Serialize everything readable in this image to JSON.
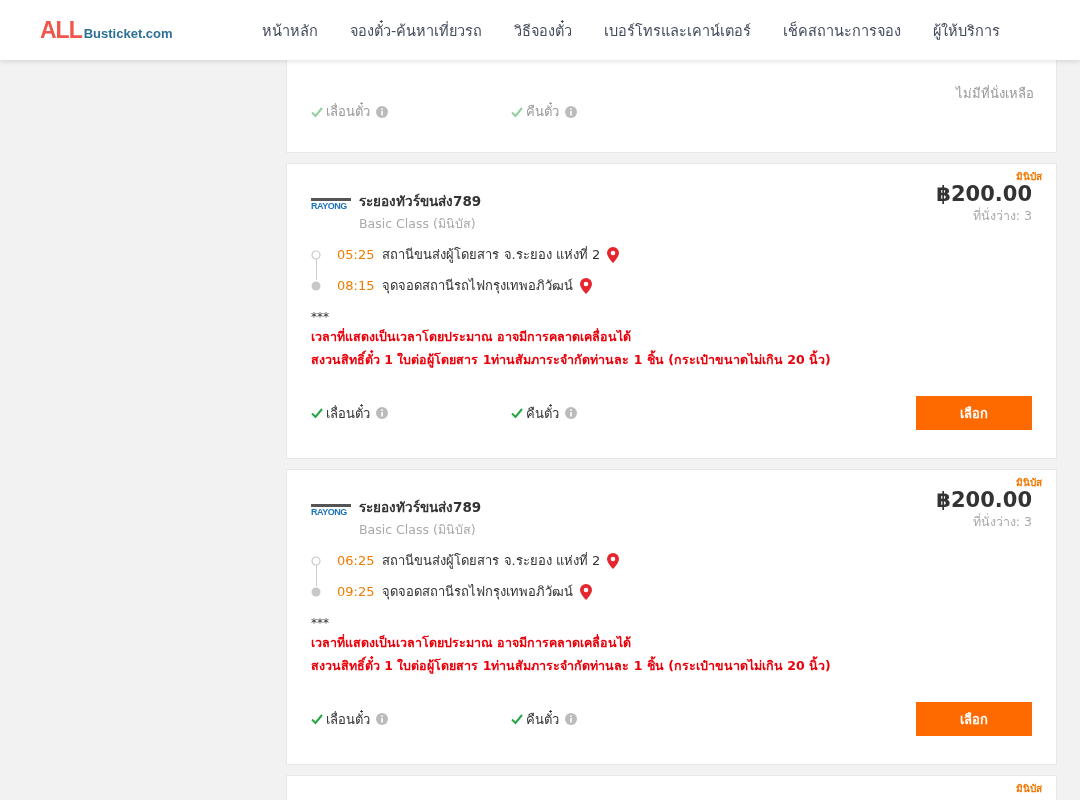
{
  "logo": {
    "part_1": "ALL",
    "part_2": "Busticket.com"
  },
  "nav": [
    {
      "label": "หน้าหลัก"
    },
    {
      "label": "จองตั๋ว-ค้นหาเที่ยวรถ"
    },
    {
      "label": "วิธีจองตั๋ว"
    },
    {
      "label": "เบอร์โทรและเคาน์เตอร์"
    },
    {
      "label": "เช็คสถานะการจอง"
    },
    {
      "label": "ผู้ให้บริการ"
    }
  ],
  "trips": [
    {
      "available": false,
      "status": "ไม่มีที่นั่งเหลือ",
      "features": [
        {
          "label": "เลื่อนตั๋ว",
          "checked": true
        },
        {
          "label": "คืนตั๋ว",
          "checked": true
        }
      ]
    },
    {
      "available": true,
      "tag": "มินิบัส",
      "operator_logo": "RAYONG",
      "operator": "ระยองทัวร์ขนส่ง789",
      "class": "Basic Class (มินิบัส)",
      "price": "฿200.00",
      "seats": "ที่นั่งว่าง: 3",
      "stops": [
        {
          "time": "05:25",
          "place": "สถานีขนส่งผู้โดยสาร จ.ระยอง แห่งที่ 2"
        },
        {
          "time": "08:15",
          "place": "จุดจอดสถานีรถไฟกรุงเทพอภิวัฒน์"
        }
      ],
      "note_mark": "***",
      "notes": [
        "เวลาที่แสดงเป็นเวลาโดยประมาณ อาจมีการคลาดเคลื่อนได้",
        "สงวนสิทธิ์ตั๋ว 1 ใบต่อผู้โดยสาร 1ท่านสัมภาระจำกัดท่านละ 1 ชิ้น (กระเป๋าขนาดไม่เกิน 20 นิ้ว)"
      ],
      "features": [
        {
          "label": "เลื่อนตั๋ว",
          "checked": true
        },
        {
          "label": "คืนตั๋ว",
          "checked": true
        }
      ],
      "button": "เลือก"
    },
    {
      "available": true,
      "tag": "มินิบัส",
      "operator_logo": "RAYONG",
      "operator": "ระยองทัวร์ขนส่ง789",
      "class": "Basic Class (มินิบัส)",
      "price": "฿200.00",
      "seats": "ที่นั่งว่าง: 3",
      "stops": [
        {
          "time": "06:25",
          "place": "สถานีขนส่งผู้โดยสาร จ.ระยอง แห่งที่ 2"
        },
        {
          "time": "09:25",
          "place": "จุดจอดสถานีรถไฟกรุงเทพอภิวัฒน์"
        }
      ],
      "note_mark": "***",
      "notes": [
        "เวลาที่แสดงเป็นเวลาโดยประมาณ อาจมีการคลาดเคลื่อนได้",
        "สงวนสิทธิ์ตั๋ว 1 ใบต่อผู้โดยสาร 1ท่านสัมภาระจำกัดท่านละ 1 ชิ้น (กระเป๋าขนาดไม่เกิน 20 นิ้ว)"
      ],
      "features": [
        {
          "label": "เลื่อนตั๋ว",
          "checked": true
        },
        {
          "label": "คืนตั๋ว",
          "checked": true
        }
      ],
      "button": "เลือก"
    },
    {
      "tag": "มินิบัส"
    }
  ]
}
